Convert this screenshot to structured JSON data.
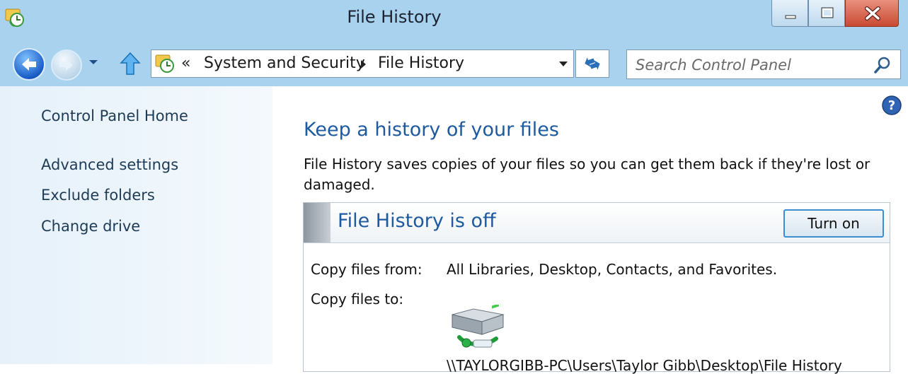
{
  "window": {
    "title": "File History"
  },
  "navigation": {
    "breadcrumb_prefix": "«",
    "breadcrumbs": [
      "System and Security",
      "File History"
    ],
    "search_placeholder": "Search Control Panel"
  },
  "sidebar": {
    "items": [
      {
        "label": "Control Panel Home"
      },
      {
        "label": "Advanced settings"
      },
      {
        "label": "Exclude folders"
      },
      {
        "label": "Change drive"
      }
    ]
  },
  "main": {
    "heading": "Keep a history of your files",
    "description": "File History saves copies of your files so you can get them back if they're lost or damaged.",
    "status": {
      "title": "File History is off",
      "button_label": "Turn on",
      "copy_from_label": "Copy files from:",
      "copy_from_value": "All Libraries, Desktop, Contacts, and Favorites.",
      "copy_to_label": "Copy files to:",
      "copy_to_path": "\\\\TAYLORGIBB-PC\\Users\\Taylor Gibb\\Desktop\\File History"
    }
  },
  "colors": {
    "chrome": "#a9d2ee",
    "link": "#1e3b56",
    "heading": "#1e5aa0",
    "button_border": "#3c8ed0"
  },
  "icons": {
    "app": "file-history-icon",
    "back": "back-arrow-icon",
    "forward": "forward-arrow-icon",
    "up": "up-arrow-icon",
    "refresh": "refresh-icon",
    "search": "search-icon",
    "help": "help-icon",
    "drive": "network-drive-icon"
  }
}
